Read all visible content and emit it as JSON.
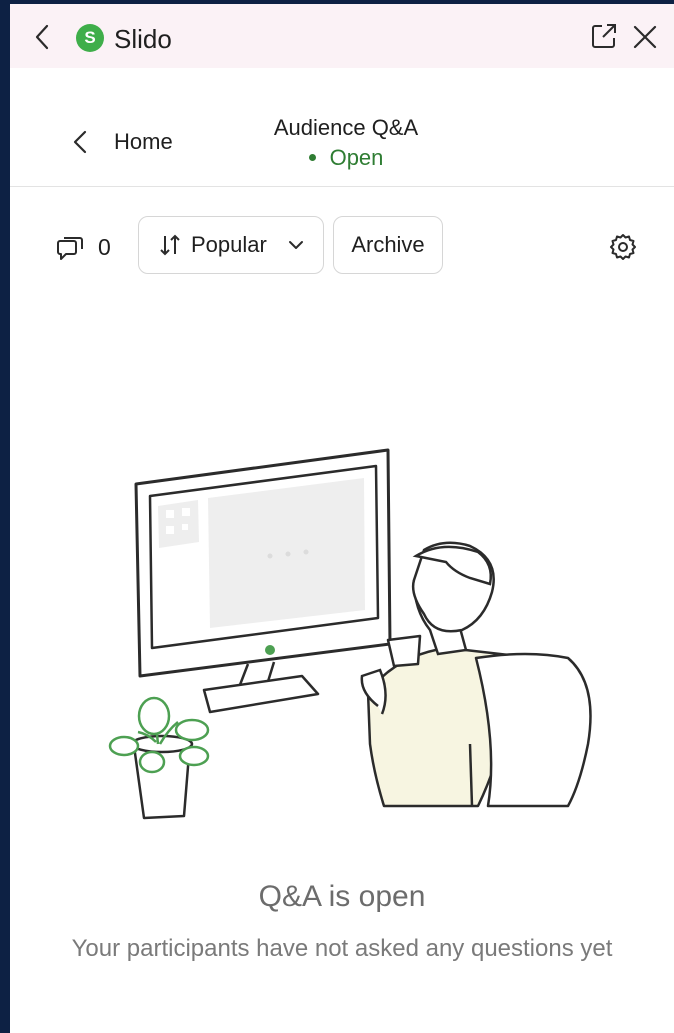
{
  "titlebar": {
    "app_name": "Slido",
    "logo_letter": "S",
    "back_icon": "chevron-left-icon",
    "popout_icon": "external-link-icon",
    "close_icon": "close-icon"
  },
  "header": {
    "home_label": "Home",
    "session_title": "Audience Q&A",
    "session_status": "Open"
  },
  "toolbar": {
    "question_count": "0",
    "sort_label": "Popular",
    "archive_label": "Archive"
  },
  "empty_state": {
    "title": "Q&A is open",
    "subtitle": "Your participants have not asked any questions yet"
  },
  "colors": {
    "brand_green": "#3fae4a",
    "status_green": "#2f7d33",
    "titlebar_bg": "#fbf2f6",
    "frame_bg": "#0d2144"
  }
}
